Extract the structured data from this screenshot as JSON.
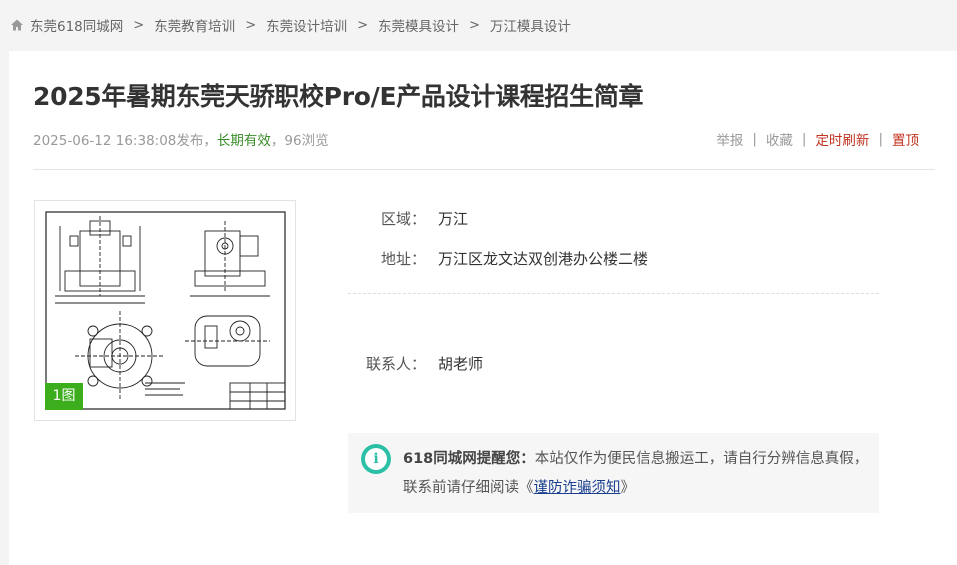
{
  "breadcrumb": {
    "items": [
      "东莞618同城网",
      "东莞教育培训",
      "东莞设计培训",
      "东莞模具设计",
      "万江模具设计"
    ],
    "separator": ">"
  },
  "listing": {
    "title": "2025年暑期东莞天骄职校Pro/E产品设计课程招生简章",
    "publish_time": "2025-06-12 16:38:08",
    "publish_suffix": "发布",
    "comma": "，",
    "validity": "长期有效",
    "views": "96浏览"
  },
  "actions": {
    "report": "举报",
    "favorite": "收藏",
    "timed_refresh": "定时刷新",
    "pin_top": "置顶",
    "separator": "|"
  },
  "photo": {
    "badge": "1图"
  },
  "info": {
    "area_label": "区域：",
    "area_value": "万江",
    "address_label": "地址：",
    "address_value": "万江区龙文达双创港办公楼二楼",
    "contact_label": "联系人：",
    "contact_value": "胡老师"
  },
  "notice": {
    "brand": "618同城网提醒您：",
    "body": "本站仅作为便民信息搬运工，请自行分辨信息真假，联系前请仔细阅读",
    "link_open": "《",
    "link_text": "谨防诈骗须知",
    "link_close": "》"
  },
  "colors": {
    "validity": "#3a8c2a",
    "red_action": "#c0331f",
    "badge": "#3cae1e",
    "info_icon": "#2bbfa8",
    "link": "#1a3f8f"
  },
  "icons": {
    "home": "home-icon",
    "info": "info-icon"
  }
}
